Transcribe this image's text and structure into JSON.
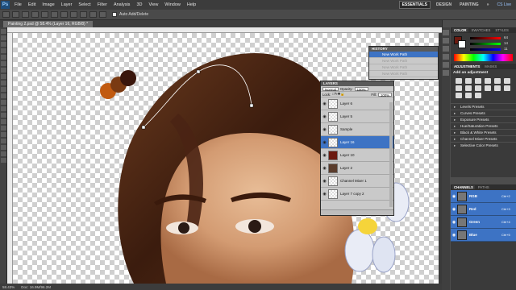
{
  "app": {
    "logo": "Ps"
  },
  "menu": {
    "items": [
      "File",
      "Edit",
      "Image",
      "Layer",
      "Select",
      "Filter",
      "Analysis",
      "3D",
      "View",
      "Window",
      "Help"
    ]
  },
  "workspace": {
    "essentials": "ESSENTIALS",
    "design": "DESIGN",
    "painting": "PAINTING",
    "more": "»",
    "cslive": "CS Live"
  },
  "options": {
    "auto_add_delete": "Auto Add/Delete"
  },
  "document": {
    "tab": "Painting 2.psd @ 58.4% (Layer 16, RGB/8) *"
  },
  "status": {
    "zoom": "58.43%",
    "doc": "Doc: 16.9M/96.2M"
  },
  "history": {
    "title": "HISTORY",
    "rows": [
      {
        "label": "New Work Path",
        "selected": true
      },
      {
        "label": "New Work Path",
        "selected": false
      },
      {
        "label": "New Work Path",
        "selected": false
      },
      {
        "label": "New Work Path",
        "selected": false
      }
    ]
  },
  "layers": {
    "title": "LAYERS",
    "blend_mode": "Normal",
    "opacity_label": "Opacity:",
    "opacity_value": "100%",
    "lock_label": "Lock:",
    "fill_label": "Fill:",
    "fill_value": "100%",
    "rows": [
      {
        "name": "Layer 6",
        "thumb": "transparent",
        "selected": false
      },
      {
        "name": "Layer 5",
        "thumb": "transparent",
        "selected": false
      },
      {
        "name": "Sample",
        "thumb": "transparent",
        "selected": false
      },
      {
        "name": "Layer 16",
        "thumb": "transparent",
        "selected": true
      },
      {
        "name": "Layer 10",
        "thumb": "red",
        "selected": false
      },
      {
        "name": "Layer 2",
        "thumb": "face",
        "selected": false
      },
      {
        "name": "Channel Mixer 1",
        "thumb": "transparent",
        "selected": false
      },
      {
        "name": "Layer 7 copy 2",
        "thumb": "transparent",
        "selected": false
      }
    ]
  },
  "colorpanel": {
    "tabs": [
      "COLOR",
      "SWATCHES",
      "STYLES"
    ],
    "r": "64",
    "g": "14",
    "b": "11"
  },
  "adjustments": {
    "tabs": [
      "ADJUSTMENTS",
      "MASKS"
    ],
    "title": "Add an adjustment",
    "presets": [
      "Levels Presets",
      "Curves Presets",
      "Exposure Presets",
      "Hue/Saturation Presets",
      "Black & White Presets",
      "Channel Mixer Presets",
      "Selective Color Presets"
    ]
  },
  "channels": {
    "tabs": [
      "CHANNELS",
      "PATHS"
    ],
    "rows": [
      {
        "name": "RGB",
        "key": "Ctrl+2"
      },
      {
        "name": "Red",
        "key": "Ctrl+3"
      },
      {
        "name": "Green",
        "key": "Ctrl+4"
      },
      {
        "name": "Blue",
        "key": "Ctrl+5"
      }
    ]
  },
  "colors": {
    "swatch1": "#c15a10",
    "swatch2": "#7a3a12",
    "swatch3": "#3a160c",
    "hair": "#4a2414",
    "skin": "#d8a57c",
    "selection": "#3d73c4"
  }
}
